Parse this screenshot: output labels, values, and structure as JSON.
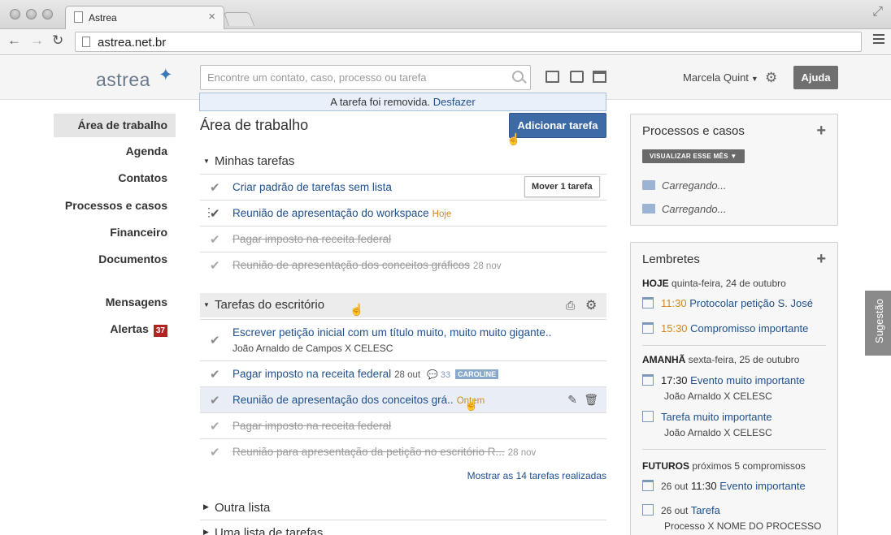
{
  "browser": {
    "tab_title": "Astrea",
    "url": "astrea.net.br"
  },
  "header": {
    "logo": "astrea",
    "search_placeholder": "Encontre um contato, caso, processo ou tarefa",
    "user_name": "Marcela Quint",
    "help_label": "Ajuda"
  },
  "notice": {
    "text": "A tarefa foi removida.",
    "undo": "Desfazer"
  },
  "sidebar": {
    "items": [
      {
        "label": "Área de trabalho"
      },
      {
        "label": "Agenda"
      },
      {
        "label": "Contatos"
      },
      {
        "label": "Processos e casos"
      },
      {
        "label": "Financeiro"
      },
      {
        "label": "Documentos"
      },
      {
        "label": "Mensagens"
      },
      {
        "label": "Alertas",
        "badge": "37"
      }
    ]
  },
  "main": {
    "title": "Área de trabalho",
    "add_task": "Adicionar tarefa",
    "tooltip": "Mover 1 tarefa",
    "lists": [
      {
        "name": "Minhas tarefas"
      },
      {
        "name": "Tarefas do escritório"
      },
      {
        "name": "Outra lista"
      },
      {
        "name": "Uma lista de tarefas"
      }
    ],
    "my_tasks": [
      {
        "title": "Criar padrão de tarefas sem lista"
      },
      {
        "title": "Reunião de apresentação do workspace",
        "tag": "Hoje"
      },
      {
        "title": "Pagar imposto na receita federal"
      },
      {
        "title": "Reunião de apresentação dos conceitos gráficos",
        "date": "28 nov"
      }
    ],
    "office_tasks": [
      {
        "title": "Escrever petição inicial com um título muito, muito muito gigante..",
        "sub": "João Arnaldo de Campos X CELESC"
      },
      {
        "title": "Pagar imposto na receita federal",
        "date": "28 out",
        "comments": "33",
        "label": "CAROLINE"
      },
      {
        "title": "Reunião de apresentação dos conceitos grá..",
        "tag": "Ontem"
      },
      {
        "title": "Pagar imposto na receita federal"
      },
      {
        "title": "Reunião para apresentação da petição no escritório R...",
        "date": "28 nov"
      }
    ],
    "show_done": "Mostrar as 14 tarefas realizadas"
  },
  "processes_panel": {
    "title": "Processos e casos",
    "filter_button": "VISUALIZAR ESSE MÊS",
    "loading": [
      "Carregando...",
      "Carregando..."
    ]
  },
  "reminders_panel": {
    "title": "Lembretes",
    "today": {
      "label": "HOJE",
      "date": "quinta-feira, 24 de outubro"
    },
    "today_items": [
      {
        "time": "11:30",
        "title": "Protocolar petição S. José"
      },
      {
        "time": "15:30",
        "title": "Compromisso importante"
      }
    ],
    "tomorrow": {
      "label": "AMANHÃ",
      "date": "sexta-feira, 25 de outubro"
    },
    "tomorrow_items": [
      {
        "time": "17:30",
        "title": "Evento muito importante",
        "sub": "João Arnaldo X CELESC"
      },
      {
        "title": "Tarefa muito importante",
        "sub": "João Arnaldo X CELESC"
      }
    ],
    "future": {
      "label": "FUTUROS",
      "date": "próximos 5 compromissos"
    },
    "future_items": [
      {
        "date": "26 out",
        "time": "11:30",
        "title": "Evento importante"
      },
      {
        "date": "26 out",
        "title": "Tarefa",
        "sub": "Processo X NOME DO PROCESSO"
      }
    ]
  },
  "feedback_tab": "Sugestão"
}
